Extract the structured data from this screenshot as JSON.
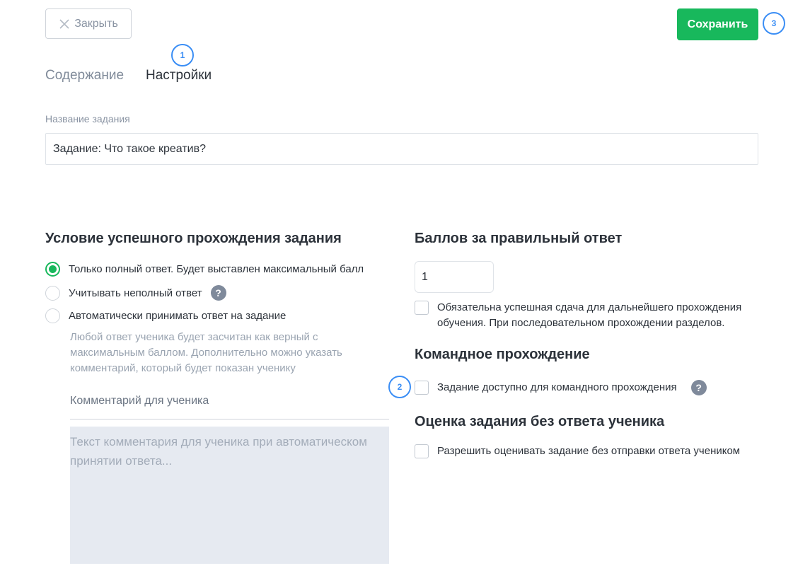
{
  "header": {
    "close_label": "Закрыть",
    "save_label": "Сохранить"
  },
  "markers": [
    "1",
    "2",
    "3"
  ],
  "tabs": [
    {
      "label": "Содержание",
      "active": false
    },
    {
      "label": "Настройки",
      "active": true
    }
  ],
  "task_name": {
    "label": "Название задания",
    "value": "Задание: Что такое креатив?"
  },
  "pass_condition": {
    "title": "Условие успешного прохождения задания",
    "options": [
      {
        "label": "Только полный ответ. Будет выставлен максимальный балл",
        "checked": true
      },
      {
        "label": "Учитывать неполный ответ",
        "checked": false
      },
      {
        "label": "Автоматически принимать ответ на задание",
        "checked": false
      }
    ],
    "hint": "Любой ответ ученика будет засчитан как верный с максимальным баллом. Дополнительно можно указать комментарий, который будет показан ученику",
    "comment_label": "Комментарий для ученика",
    "comment_placeholder": "Текст комментария для ученика при автоматическом принятии ответа..."
  },
  "points": {
    "title": "Баллов за правильный ответ",
    "value": "1",
    "required_label": "Обязательна успешная сдача для дальнейшего прохождения обучения. При последовательном прохождении разделов."
  },
  "team": {
    "title": "Командное прохождение",
    "checkbox_label": "Задание доступно для командного прохождения"
  },
  "grading": {
    "title": "Оценка задания без ответа ученика",
    "checkbox_label": "Разрешить оценивать задание без отправки ответа учеником"
  },
  "help_symbol": "?",
  "colors": {
    "accent_green": "#18b85c",
    "marker_blue": "#3b8ef5",
    "muted_text": "#8a94a3",
    "comment_bg": "#e6eaf1"
  },
  "icons": [
    "close-icon",
    "help-icon"
  ]
}
